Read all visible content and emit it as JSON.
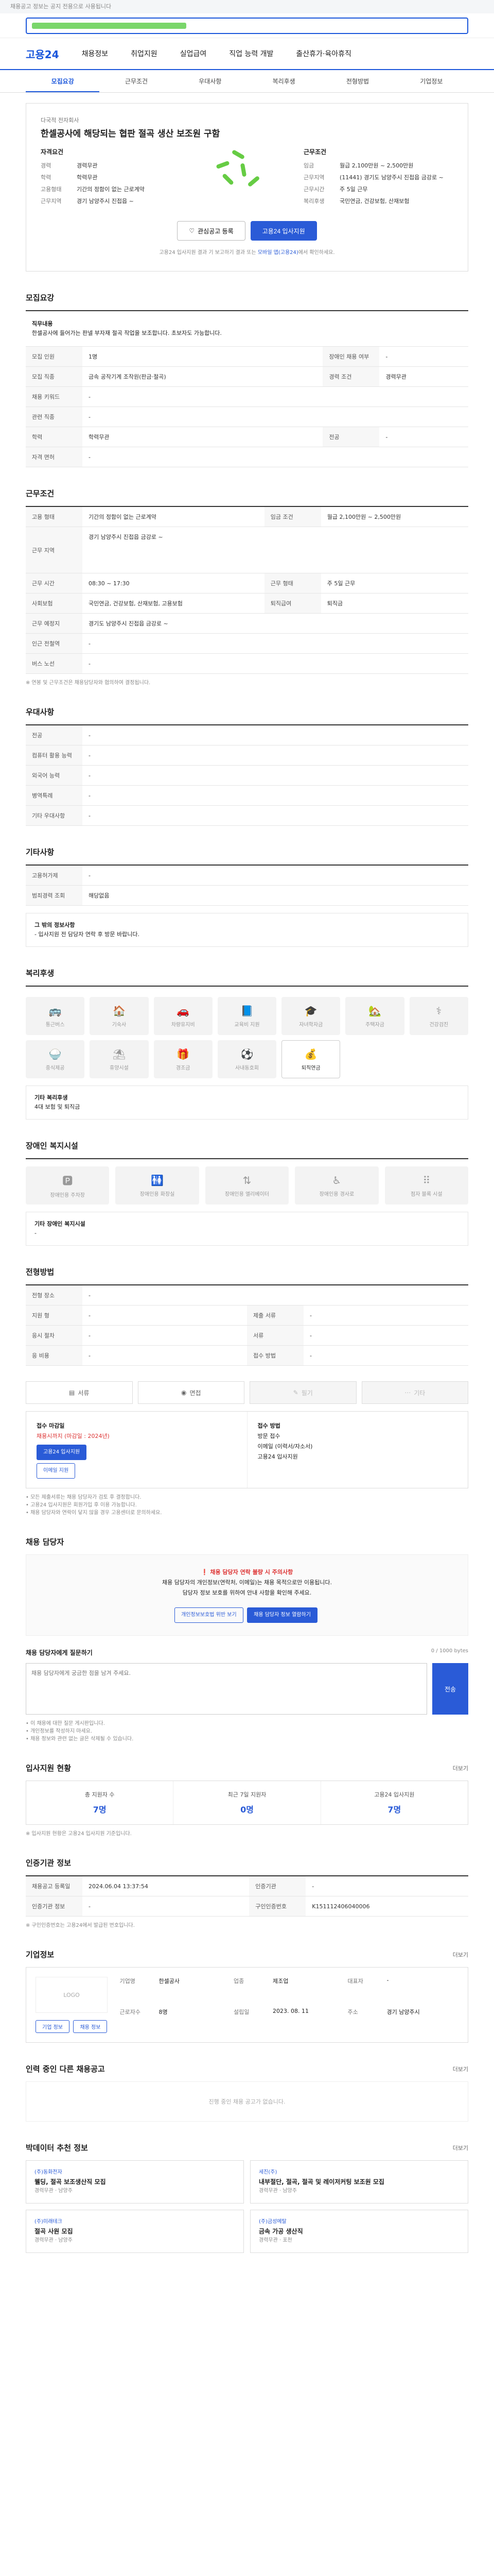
{
  "notice": "채용공고 정보는 공지 전용으로 사용됩니다",
  "logo": "고용24",
  "gnb": [
    "채용정보",
    "취업지원",
    "실업급여",
    "직업 능력 개발",
    "출산휴가·육아휴직"
  ],
  "tabs": [
    "모집요강",
    "근무조건",
    "우대사항",
    "복리후생",
    "전형방법",
    "기업정보"
  ],
  "header": {
    "company": "다국적 전자회사",
    "title": "한셀공사에 해당되는 협판 절곡 생산 보조원 구함",
    "left_title": "자격요건",
    "left": [
      {
        "k": "경력",
        "v": "경력무관"
      },
      {
        "k": "학력",
        "v": "학력무관"
      },
      {
        "k": "고용형태",
        "v": "기간의 정함이 없는 근로계약"
      },
      {
        "k": "근무지역",
        "v": "경기 남양주시 진접읍 ~"
      }
    ],
    "right_title": "근무조건",
    "right": [
      {
        "k": "임금",
        "v": "월급 2,100만원 ~ 2,500만원"
      },
      {
        "k": "근무지역",
        "v": "(11441) 경기도 남양주시 진접읍 금강로 ~"
      },
      {
        "k": "근무시간",
        "v": "주 5일 근무"
      },
      {
        "k": "복리후생",
        "v": "국민연금, 건강보험, 산재보험"
      }
    ],
    "save_btn": "관심공고 등록",
    "apply_btn": "고용24 입사지원",
    "note_pre": "고용24 입사지원 결과 기 보고하기 결과 또는 ",
    "note_hl": "모바일 앱(고용24)",
    "note_post": "에서 확인하세요."
  },
  "recruit": {
    "title": "모집요강",
    "duty_label": "직무내용",
    "duty": "한셀공사에 들어가는 판넬 부자재 절곡 작업을 보조합니다. 초보자도 가능합니다.",
    "rows": [
      {
        "k": "모집 인원",
        "v": "1명",
        "k2": "장애인 채용 여부",
        "v2": "-"
      },
      {
        "k": "모집 직종",
        "v": "금속 공작기계 조작원(판금·절곡)",
        "k2": "경력 조건",
        "v2": "경력무관"
      },
      {
        "k": "채용 키워드",
        "v": "-",
        "k2": "",
        "v2": ""
      },
      {
        "k": "관련 직종",
        "v": "-",
        "k2": "",
        "v2": ""
      },
      {
        "k": "학력",
        "v": "학력무관",
        "k2": "전공",
        "v2": "-"
      },
      {
        "k": "자격 면허",
        "v": "-",
        "k2": "",
        "v2": ""
      }
    ]
  },
  "work": {
    "title": "근무조건",
    "rows": [
      {
        "k": "고용 형태",
        "v": "기간의 정함이 없는 근로계약",
        "k2": "임금 조건",
        "v2": "월급 2,100만원 ~ 2,500만원"
      },
      {
        "k": "근무 지역",
        "v": "경기 남양주시 진접읍 금강로 ~",
        "k2": "",
        "v2": ""
      },
      {
        "k": "근무 시간",
        "v": "08:30 ~ 17:30",
        "k2": "근무 형태",
        "v2": "주 5일 근무"
      },
      {
        "k": "사회보험",
        "v": "국민연금, 건강보험, 산재보험, 고용보험",
        "k2": "퇴직급여",
        "v2": "퇴직금"
      },
      {
        "k": "근무 예정지",
        "v": "경기도 남양주시 진접읍 금강로 ~",
        "k2": "",
        "v2": ""
      },
      {
        "k": "인근 전철역",
        "v": "-",
        "k2": "",
        "v2": ""
      },
      {
        "k": "버스 노선",
        "v": "-",
        "k2": "",
        "v2": ""
      }
    ],
    "note": "※ 연봉 및 근무조건은 채용담당자와 협의하여 결정됩니다."
  },
  "prefer": {
    "title": "우대사항",
    "rows": [
      {
        "k": "전공",
        "v": "-"
      },
      {
        "k": "컴퓨터 활용 능력",
        "v": "-"
      },
      {
        "k": "외국어 능력",
        "v": "-"
      },
      {
        "k": "병역특례",
        "v": "-"
      },
      {
        "k": "기타 우대사항",
        "v": "-"
      }
    ]
  },
  "etc": {
    "title": "기타사항",
    "rows": [
      {
        "k": "고용허가제",
        "v": "-"
      },
      {
        "k": "범죄경력 조회",
        "v": "해당없음"
      }
    ],
    "info_title": "그 밖의 정보사항",
    "info": "- 입사지원 전 담당자 연락 후 방문 바랍니다."
  },
  "welfare": {
    "title": "복리후생",
    "items": [
      {
        "label": "통근버스",
        "on": false,
        "icon": "bus-icon",
        "g": "🚌"
      },
      {
        "label": "기숙사",
        "on": false,
        "icon": "home-icon",
        "g": "🏠"
      },
      {
        "label": "차량유지비",
        "on": false,
        "icon": "car-icon",
        "g": "🚗"
      },
      {
        "label": "교육비 지원",
        "on": false,
        "icon": "book-icon",
        "g": "📘"
      },
      {
        "label": "자녀학자금",
        "on": false,
        "icon": "child-icon",
        "g": "🎓"
      },
      {
        "label": "주택자금",
        "on": false,
        "icon": "house-icon",
        "g": "🏡"
      },
      {
        "label": "건강검진",
        "on": false,
        "icon": "health-icon",
        "g": "⚕"
      },
      {
        "label": "중식제공",
        "on": false,
        "icon": "meal-icon",
        "g": "🍚"
      },
      {
        "label": "휴양시설",
        "on": false,
        "icon": "rest-icon",
        "g": "⛱"
      },
      {
        "label": "경조금",
        "on": false,
        "icon": "gift-icon",
        "g": "🎁"
      },
      {
        "label": "사내동호회",
        "on": false,
        "icon": "club-icon",
        "g": "⚽"
      },
      {
        "label": "퇴직연금",
        "on": true,
        "icon": "pension-icon",
        "g": "💰"
      }
    ],
    "etc_label": "기타 복리후생",
    "etc_value": "4대 보험 및 퇴직금"
  },
  "disabled": {
    "title": "장애인 복지시설",
    "items": [
      "장애인용 주차장",
      "장애인용 화장실",
      "장애인용 엘리베이터",
      "장애인용 경사로",
      "점자 블록 시설"
    ],
    "etc_label": "기타 장애인 복지시설",
    "etc_value": "-"
  },
  "method": {
    "title": "전형방법",
    "rows": [
      {
        "k": "전형 장소",
        "v": "-"
      },
      {
        "k": "지원 형",
        "v": "-",
        "k2": "제출 서류",
        "v2": "-"
      },
      {
        "k": "응시 절차",
        "v": "-",
        "k2": "서류",
        "v2": "-"
      },
      {
        "k": "응 비용",
        "v": "-",
        "k2": "접수 방법",
        "v2": "-"
      }
    ],
    "types": [
      {
        "label": "서류",
        "off": false
      },
      {
        "label": "면접",
        "off": false
      },
      {
        "label": "필기",
        "off": true
      },
      {
        "label": "기타",
        "off": true
      }
    ]
  },
  "apply": {
    "left_title": "접수 마감일",
    "deadline": "채용시까지 (마감일 : 2024년)",
    "btn1": "고용24 입사지원",
    "btn2": "이메일 지원",
    "right_title": "접수 방법",
    "right_lines": [
      "방문 접수",
      "이메일 (이력서/자소서)",
      "고용24 입사지원"
    ],
    "notes": [
      "• 모든 제출서류는 채용 담당자가 검토 후 결정합니다.",
      "• 고용24 입사지원은 회원가입 후 이용 가능합니다.",
      "• 채용 담당자와 연락이 닿지 않을 경우 고용센터로 문의하세요."
    ]
  },
  "contact": {
    "title": "채용 담당자",
    "warn": "채용 담당자 연락 불량 시 주의사항",
    "line1": "채용 담당자의 개인정보(연락처, 이메일)는 채용 목적으로만 이용됩니다.",
    "line2": "담당자 정보 보호를 위하여 안내 사항을 확인해 주세요.",
    "b1": "개인정보보호법 위반 보기",
    "b2": "채용 담당자 정보 열람하기",
    "qa_title": "채용 담당자에게 질문하기",
    "qa_counter": "0 / 1000 bytes",
    "qa_placeholder": "채용 담당자에게 궁금한 점을 남겨 주세요.",
    "qa_send": "전송",
    "qa_notes": [
      "• 이 채용에 대한 질문 게시판입니다.",
      "• 개인정보를 작성하지 마세요.",
      "• 채용 정보와 관련 없는 글은 삭제될 수 있습니다."
    ]
  },
  "stats": {
    "title": "입사지원 현황",
    "more": "더보기",
    "items": [
      {
        "label": "총 지원자 수",
        "n": "7명"
      },
      {
        "label": "최근 7일 지원자",
        "n": "0명"
      },
      {
        "label": "고용24 입사지원",
        "n": "7명"
      }
    ],
    "note": "※ 입사지원 현황은 고용24 입사지원 기준입니다."
  },
  "info": {
    "title": "인증기관 정보",
    "rows": [
      {
        "k": "채용공고 등록일",
        "v": "2024.06.04 13:37:54",
        "k2": "인증기관",
        "v2": "-"
      },
      {
        "k": "인증기관 정보",
        "v": "-",
        "k2": "구인인증번호",
        "v2": "K151112406040006"
      }
    ],
    "note": "※ 구인인증번호는 고용24에서 발급된 번호입니다."
  },
  "company": {
    "title": "기업정보",
    "more": "더보기",
    "logo_text": "LOGO",
    "rows": [
      {
        "k": "기업명",
        "v": "한셀공사"
      },
      {
        "k": "업종",
        "v": "제조업"
      },
      {
        "k": "대표자",
        "v": "-"
      },
      {
        "k": "근로자수",
        "v": "8명"
      },
      {
        "k": "설립일",
        "v": "2023. 08. 11"
      },
      {
        "k": "주소",
        "v": "경기 남양주시"
      }
    ],
    "b1": "기업 정보",
    "b2": "채용 정보"
  },
  "others": {
    "title": "인력 중인 다른 채용공고",
    "more": "더보기",
    "empty": "진행 중인 채용 공고가 없습니다."
  },
  "recommend": {
    "title": "박데이터 추천 정보",
    "more": "더보기",
    "items": [
      {
        "co": "(주)동화전자",
        "t": "웰딩, 절곡 보조생산직 모집",
        "m": "경력무관 · 남양주"
      },
      {
        "co": "세진(주)",
        "t": "내부절단, 절곡, 절곡 및 레이저커팅 보조원 모집",
        "m": "경력무관 · 남양주"
      },
      {
        "co": "(주)미래테크",
        "t": "절곡 사원 모집",
        "m": "경력무관 · 남양주"
      },
      {
        "co": "(주)금성메탈",
        "t": "금속 가공 생산직",
        "m": "경력무관 · 포천"
      }
    ]
  }
}
